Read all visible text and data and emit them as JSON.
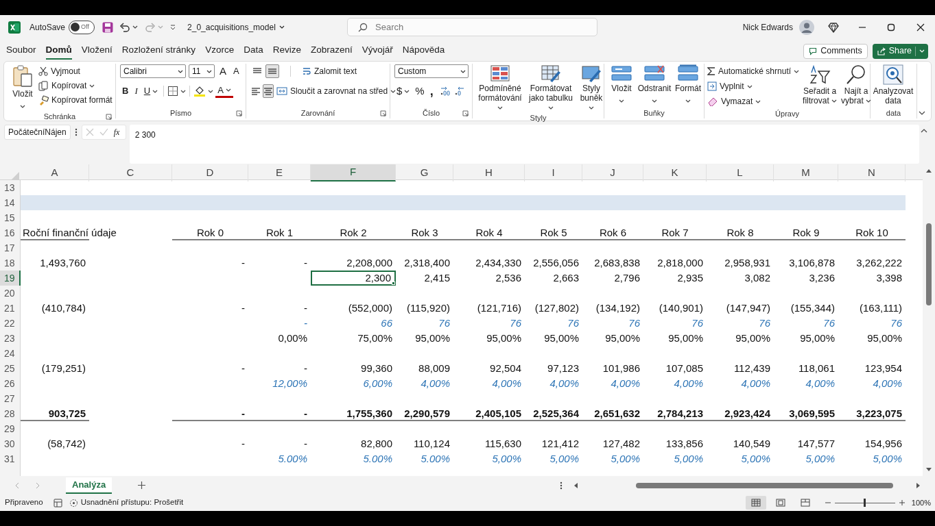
{
  "title_bar": {
    "autosave_label": "AutoSave",
    "autosave": {
      "on": false,
      "text": "Off"
    },
    "filename": "2_0_acquisitions_model",
    "search": {
      "placeholder": "Search"
    },
    "user": "Nick Edwards"
  },
  "menu": {
    "tabs": [
      {
        "label": "Soubor",
        "selected": false
      },
      {
        "label": "Domů",
        "selected": true
      },
      {
        "label": "Vložení",
        "selected": false
      },
      {
        "label": "Rozložení stránky",
        "selected": false
      },
      {
        "label": "Vzorce",
        "selected": false
      },
      {
        "label": "Data",
        "selected": false
      },
      {
        "label": "Revize",
        "selected": false
      },
      {
        "label": "Zobrazení",
        "selected": false
      },
      {
        "label": "Vývojář",
        "selected": false
      },
      {
        "label": "Nápověda",
        "selected": false
      }
    ],
    "comments": "Comments",
    "share": "Share"
  },
  "ribbon": {
    "groups": [
      {
        "label": "Schránka",
        "items": [
          {
            "label": "Vložit"
          },
          {
            "label": "Vyjmout"
          },
          {
            "label": "Kopírovat"
          },
          {
            "label": "Kopírovat formát"
          }
        ]
      },
      {
        "label": "Písmo",
        "items": [
          {
            "value": "Calibri"
          },
          {
            "value": "11"
          },
          {
            "text": "A"
          },
          {
            "text": "A"
          },
          {
            "text": "B"
          },
          {
            "text": "I"
          },
          {
            "text": "U"
          },
          {
            "text": "A"
          }
        ]
      },
      {
        "label": "Zarovnání",
        "items": [
          {
            "selected": false
          },
          {
            "selected": true
          },
          {
            "label": "Zalomit text"
          },
          {
            "selected": false
          },
          {
            "selected": true
          },
          {
            "label": "Sloučit a zarovnat na střed"
          }
        ]
      },
      {
        "label": "Číslo",
        "items": [
          {
            "value": "Custom"
          },
          {
            "text": "$"
          },
          {
            "text": "%"
          },
          {
            "text": ","
          }
        ]
      },
      {
        "label": "Styly",
        "items": [
          {
            "label": "Podmíněné formátování"
          },
          {
            "label": "Formátovat jako tabulku"
          },
          {
            "label": "Styly buněk"
          }
        ]
      },
      {
        "label": "Buňky",
        "items": [
          {
            "label": "Vložit"
          },
          {
            "label": "Odstranit"
          },
          {
            "label": "Formát"
          }
        ]
      },
      {
        "label": "Úpravy",
        "items": [
          {
            "label": "Automatické shrnutí"
          },
          {
            "label": "Vyplnit"
          },
          {
            "label": "Vymazat"
          },
          {
            "label": "Seřadit a filtrovat"
          },
          {
            "label": "Najít a vybrat"
          }
        ]
      },
      {
        "label": "data",
        "items": [
          {
            "label": "Analyzovat data"
          }
        ]
      }
    ]
  },
  "formula_bar": {
    "name_box": "PočátečníNájen",
    "function_button": "fx",
    "value": "2 300"
  },
  "grid": {
    "columns": [
      {
        "label": "A",
        "selected": false
      },
      {
        "label": "C",
        "selected": false
      },
      {
        "label": "D",
        "selected": false
      },
      {
        "label": "E",
        "selected": false
      },
      {
        "label": "F",
        "selected": true
      },
      {
        "label": "G",
        "selected": false
      },
      {
        "label": "H",
        "selected": false
      },
      {
        "label": "I",
        "selected": false
      },
      {
        "label": "J",
        "selected": false
      },
      {
        "label": "K",
        "selected": false
      },
      {
        "label": "L",
        "selected": false
      },
      {
        "label": "M",
        "selected": false
      },
      {
        "label": "N",
        "selected": false
      }
    ],
    "rows": [
      {
        "number": "13",
        "kind": "blank",
        "selected": false
      },
      {
        "number": "14",
        "kind": "band",
        "selected": false
      },
      {
        "number": "15",
        "kind": "blank",
        "selected": false
      },
      {
        "number": "16",
        "kind": "header",
        "selected": false,
        "cells": {
          "A": "Roční finanční údaje",
          "D": "Rok 0",
          "E": "Rok 1",
          "F": "Rok 2",
          "G": "Rok 3",
          "H": "Rok 4",
          "I": "Rok 5",
          "J": "Rok 6",
          "K": "Rok 7",
          "L": "Rok 8",
          "M": "Rok 9",
          "N": "Rok 10"
        }
      },
      {
        "number": "17",
        "kind": "blank",
        "selected": false
      },
      {
        "number": "18",
        "kind": "number",
        "selected": false,
        "cells": {
          "A": "1,493,760",
          "D": "-",
          "E": "-",
          "F": "2,208,000",
          "G": "2,318,400",
          "H": "2,434,330",
          "I": "2,556,056",
          "J": "2,683,838",
          "K": "2,818,000",
          "L": "2,958,931",
          "M": "3,106,878",
          "N": "3,262,222"
        }
      },
      {
        "number": "19",
        "kind": "number",
        "selected": true,
        "cells": {
          "F": "2,300",
          "G": "2,415",
          "H": "2,536",
          "I": "2,663",
          "J": "2,796",
          "K": "2,935",
          "L": "3,082",
          "M": "3,236",
          "N": "3,398"
        }
      },
      {
        "number": "20",
        "kind": "blank",
        "selected": false
      },
      {
        "number": "21",
        "kind": "number",
        "selected": false,
        "cells": {
          "A": "(410,784)",
          "D": "-",
          "E": "-",
          "F": "(552,000)",
          "G": "(115,920)",
          "H": "(121,716)",
          "I": "(127,802)",
          "J": "(134,192)",
          "K": "(140,901)",
          "L": "(147,947)",
          "M": "(155,344)",
          "N": "(163,111)"
        }
      },
      {
        "number": "22",
        "kind": "input",
        "selected": false,
        "cells": {
          "E": "-",
          "F": "66",
          "G": "76",
          "H": "76",
          "I": "76",
          "J": "76",
          "K": "76",
          "L": "76",
          "M": "76",
          "N": "76"
        }
      },
      {
        "number": "23",
        "kind": "number",
        "selected": false,
        "cells": {
          "E": "0,00%",
          "F": "75,00%",
          "G": "95,00%",
          "H": "95,00%",
          "I": "95,00%",
          "J": "95,00%",
          "K": "95,00%",
          "L": "95,00%",
          "M": "95,00%",
          "N": "95,00%"
        }
      },
      {
        "number": "24",
        "kind": "blank",
        "selected": false
      },
      {
        "number": "25",
        "kind": "number",
        "selected": false,
        "cells": {
          "A": "(179,251)",
          "D": "-",
          "E": "-",
          "F": "99,360",
          "G": "88,009",
          "H": "92,504",
          "I": "97,123",
          "J": "101,986",
          "K": "107,085",
          "L": "112,439",
          "M": "118,061",
          "N": "123,954"
        }
      },
      {
        "number": "26",
        "kind": "input",
        "selected": false,
        "cells": {
          "E": "12,00%",
          "F": "6,00%",
          "G": "4,00%",
          "H": "4,00%",
          "I": "4,00%",
          "J": "4,00%",
          "K": "4,00%",
          "L": "4,00%",
          "M": "4,00%",
          "N": "4,00%"
        }
      },
      {
        "number": "27",
        "kind": "blank",
        "selected": false
      },
      {
        "number": "28",
        "kind": "total",
        "selected": false,
        "cells": {
          "A": "903,725",
          "D": "-",
          "E": "-",
          "F": "1,755,360",
          "G": "2,290,579",
          "H": "2,405,105",
          "I": "2,525,364",
          "J": "2,651,632",
          "K": "2,784,213",
          "L": "2,923,424",
          "M": "3,069,595",
          "N": "3,223,075"
        }
      },
      {
        "number": "29",
        "kind": "blank",
        "selected": false
      },
      {
        "number": "30",
        "kind": "number",
        "selected": false,
        "cells": {
          "A": "(58,742)",
          "D": "-",
          "E": "-",
          "F": "82,800",
          "G": "110,124",
          "H": "115,630",
          "I": "121,412",
          "J": "127,482",
          "K": "133,856",
          "L": "140,549",
          "M": "147,577",
          "N": "154,956"
        }
      },
      {
        "number": "31",
        "kind": "input",
        "selected": false,
        "cells": {
          "E": "5.00%",
          "F": "5.00%",
          "G": "5.00%",
          "H": "5,00%",
          "I": "5,00%",
          "J": "5,00%",
          "K": "5,00%",
          "L": "5,00%",
          "M": "5,00%",
          "N": "5,00%"
        }
      }
    ]
  },
  "sheet_tabs": [
    {
      "label": "Analýza",
      "selected": true
    }
  ],
  "status_bar": {
    "status": "Připraveno",
    "accessibility": "Usnadnění přístupu: Prošetřit",
    "views": [
      {
        "selected": true
      },
      {
        "selected": false
      },
      {
        "selected": false
      }
    ],
    "zoom": {
      "level": 0.5,
      "text": "100%"
    }
  }
}
